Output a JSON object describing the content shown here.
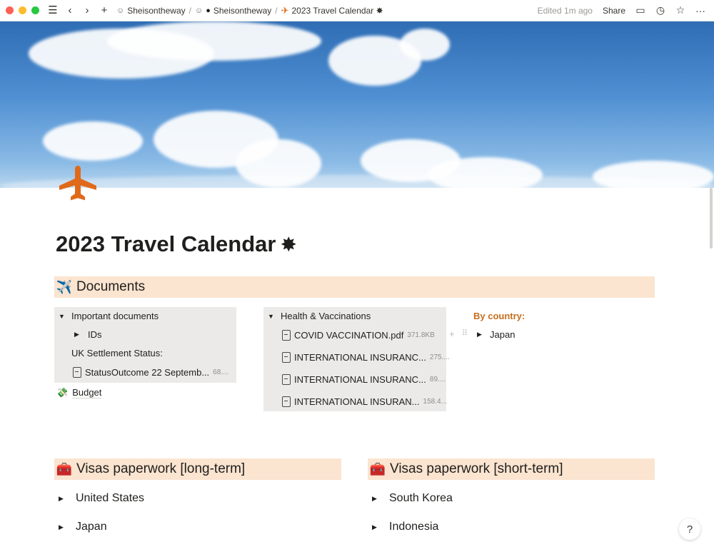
{
  "topbar": {
    "breadcrumbs": [
      {
        "label": "Sheisontheway",
        "icon": "person-icon"
      },
      {
        "label": "Sheisontheway",
        "icon": "dot-icon"
      },
      {
        "label": "2023 Travel Calendar ✸",
        "icon": "airplane-icon"
      }
    ],
    "separator": "/",
    "edited": "Edited 1m ago",
    "share": "Share"
  },
  "page": {
    "title": "2023 Travel Calendar",
    "title_glyph": "✸"
  },
  "documents": {
    "heading": "Documents",
    "heading_icon": "✈️",
    "important": {
      "label": "Important documents",
      "ids_label": "IDs",
      "uk_status": "UK Settlement Status:",
      "file": {
        "name": "StatusOutcome 22 Septemb...",
        "size": "68...."
      }
    },
    "budget": {
      "label": "Budget",
      "icon": "💸"
    },
    "health": {
      "label": "Health & Vaccinations",
      "files": [
        {
          "name": "COVID VACCINATION.pdf",
          "size": "371.8KB"
        },
        {
          "name": "INTERNATIONAL INSURANC...",
          "size": "275...."
        },
        {
          "name": "INTERNATIONAL INSURANC...",
          "size": "89...."
        },
        {
          "name": "INTERNATIONAL INSURAN...",
          "size": "158.4..."
        }
      ]
    },
    "by_country": {
      "label": "By country:",
      "items": [
        "Japan"
      ]
    }
  },
  "visas_long": {
    "heading": "Visas paperwork [long-term]",
    "icon": "🧰",
    "items": [
      "United States",
      "Japan"
    ]
  },
  "visas_short": {
    "heading": "Visas paperwork [short-term]",
    "icon": "🧰",
    "items": [
      "South Korea",
      "Indonesia"
    ]
  },
  "help": "?",
  "colors": {
    "heading_band": "#fbe4d0",
    "toggle_block": "#ebeae8",
    "accent_orange": "#c56d1e",
    "page_icon": "#e06a1b"
  }
}
